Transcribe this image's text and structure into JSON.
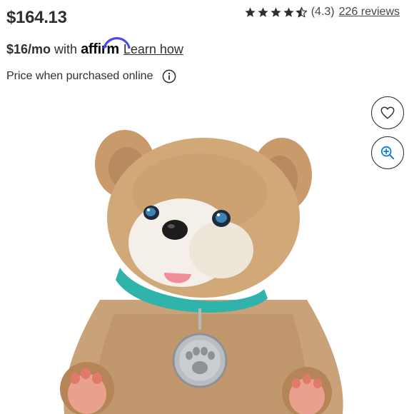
{
  "product": {
    "price": "$164.13",
    "rating": {
      "value": 4.3,
      "value_label": "(4.3)",
      "reviews_label": "226 reviews",
      "stars_filled": 4.3,
      "stars_total": 5
    },
    "affirm": {
      "monthly": "$16/mo",
      "with": "with",
      "brand": "affirm",
      "learn_label": "Learn how"
    },
    "purchase_note": "Price when purchased online"
  },
  "icons": {
    "info": "info-icon",
    "favorite": "heart-icon",
    "zoom": "zoom-in-icon",
    "star": "star-icon"
  },
  "colors": {
    "text": "#2e2f32",
    "star": "#2e2f32",
    "affirm_arc": "#4a4af4",
    "zoom_icon": "#0071dc",
    "background": "#ffffff"
  }
}
